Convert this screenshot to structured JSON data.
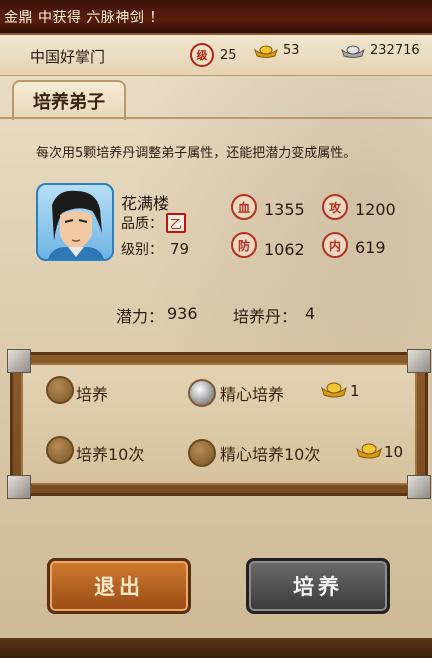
{
  "ticker": {
    "text": "金鼎 中获得 六脉神剑 ！"
  },
  "topbar": {
    "sect_name": "中国好掌门",
    "level_badge": "级",
    "level": "25",
    "gold": "53",
    "silver": "232716",
    "icons": {
      "level": "level-badge-icon",
      "gold": "gold-ingot-icon",
      "silver": "silver-ingot-icon"
    }
  },
  "tab": {
    "label": "培养弟子"
  },
  "description": "每次用5颗培养丹调整弟子属性，还能把潜力变成属性。",
  "disciple": {
    "name": "花满楼",
    "quality_label": "品质：",
    "quality": "乙",
    "level_label": "级别：",
    "level": "79",
    "stats": [
      {
        "icon_char": "血",
        "icon": "hp-icon",
        "value": "1355"
      },
      {
        "icon_char": "攻",
        "icon": "attack-icon",
        "value": "1200"
      },
      {
        "icon_char": "防",
        "icon": "defense-icon",
        "value": "1062"
      },
      {
        "icon_char": "内",
        "icon": "inner-power-icon",
        "value": "619"
      }
    ],
    "potential_label": "潜力：",
    "potential": "936",
    "pill_label": "培养丹：",
    "pills": "4"
  },
  "options": [
    {
      "label": "培养",
      "selected": false
    },
    {
      "label": "精心培养",
      "selected": true,
      "cost": "1"
    },
    {
      "label": "培养10次",
      "selected": false
    },
    {
      "label": "精心培养10次",
      "selected": false,
      "cost": "10"
    }
  ],
  "buttons": {
    "exit": "退出",
    "train": "培养"
  },
  "colors": {
    "ticker_bg": "#3a1108",
    "exit_button": "#b8622a",
    "train_button": "#4a4a4a",
    "accent_red": "#b3321f"
  }
}
